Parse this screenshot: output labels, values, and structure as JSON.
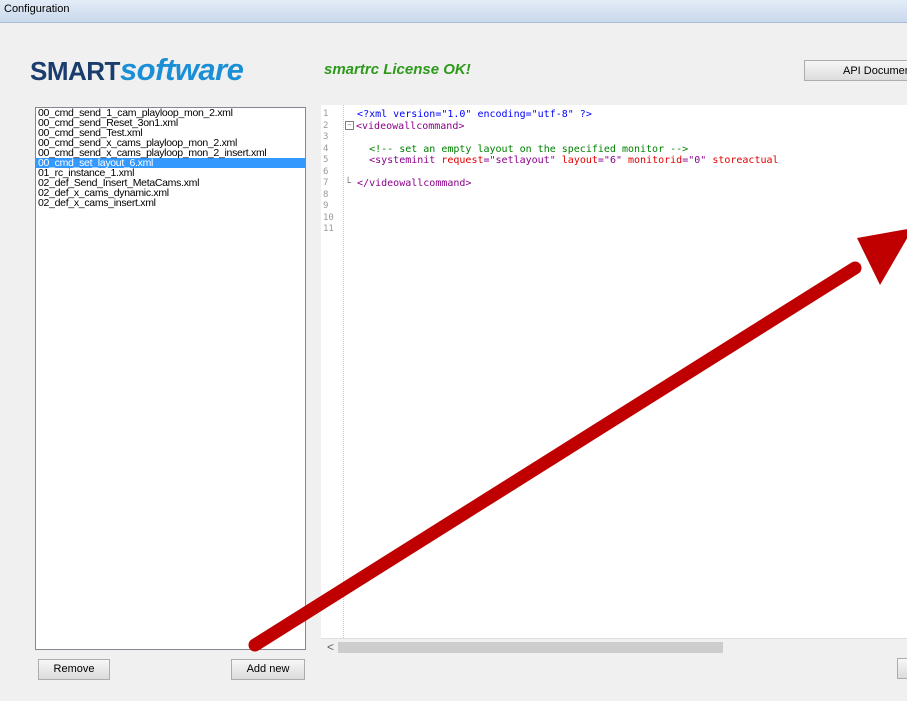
{
  "window": {
    "title": "Configuration"
  },
  "header": {
    "logo_smart": "SMART",
    "logo_software": "software",
    "license_status": "smartrc License OK!",
    "api_button": "API Documen"
  },
  "file_list": {
    "items": [
      "00_cmd_send_1_cam_playloop_mon_2.xml",
      "00_cmd_send_Reset_3on1.xml",
      "00_cmd_send_Test.xml",
      "00_cmd_send_x_cams_playloop_mon_2.xml",
      "00_cmd_send_x_cams_playloop_mon_2_insert.xml",
      "00_cmd_set_layout_6.xml",
      "01_rc_instance_1.xml",
      "02_def_Send_Insert_MetaCams.xml",
      "02_def_x_cams_dynamic.xml",
      "02_def_x_cams_insert.xml"
    ],
    "selected_index": 5
  },
  "buttons": {
    "remove": "Remove",
    "add_new": "Add new"
  },
  "editor": {
    "line_numbers": [
      "1",
      "2",
      "3",
      "4",
      "5",
      "6",
      "7",
      "8",
      "9",
      "10",
      "11"
    ],
    "lines": {
      "l1": "<?xml version=\"1.0\" encoding=\"utf-8\" ?>",
      "l2_tag": "<videowallcommand>",
      "l4_comment": "<!-- set an empty layout on the specified monitor -->",
      "l5_open": "<systeminit ",
      "l5_a1": "request",
      "l5_v1": "=\"setlayout\" ",
      "l5_a2": "layout",
      "l5_v2": "=\"6\" ",
      "l5_a3": "monitorid",
      "l5_v3": "=\"0\" ",
      "l5_a4": "storeactual",
      "l7_close": "</videowallcommand>"
    },
    "fold_open": "−",
    "scroll_left": "<"
  },
  "colors": {
    "selection": "#3399ff",
    "arrow": "#c00000",
    "license": "#2e9a1b"
  }
}
